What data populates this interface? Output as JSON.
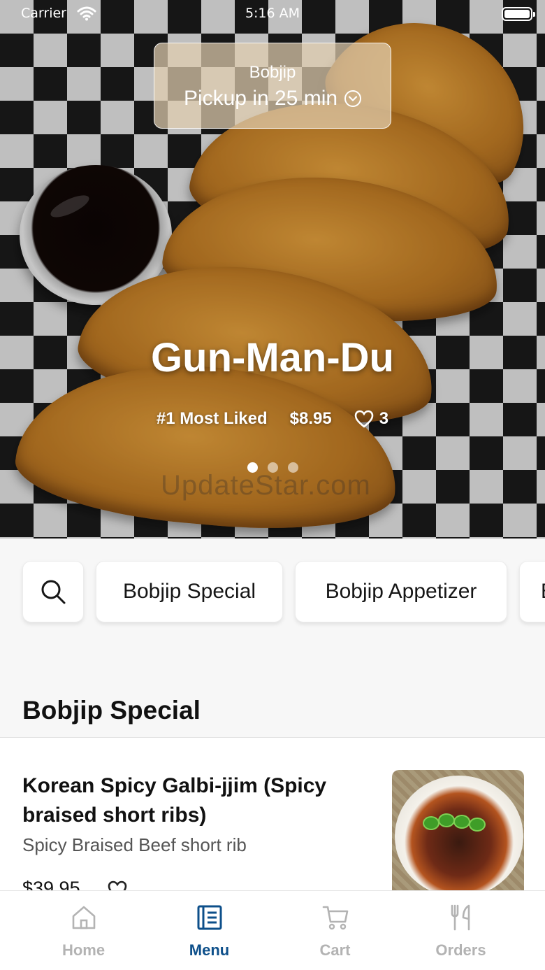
{
  "status_bar": {
    "carrier": "Carrier",
    "time": "5:16 AM"
  },
  "pickup": {
    "store": "Bobjip",
    "eta": "Pickup in 25 min"
  },
  "featured": {
    "title": "Gun-Man-Du",
    "badge": "#1 Most Liked",
    "price": "$8.95",
    "likes": "3",
    "slide_count": 3,
    "active_slide": 1
  },
  "watermark": "UpdateStar.com",
  "categories": [
    "Bobjip Special",
    "Bobjip Appetizer",
    "B"
  ],
  "section": {
    "title": "Bobjip Special"
  },
  "items": [
    {
      "name": "Korean Spicy Galbi-jjim (Spicy braised short ribs)",
      "description": "Spicy Braised Beef short rib",
      "price": "$39.95"
    }
  ],
  "tabs": [
    {
      "label": "Home",
      "icon": "home-icon"
    },
    {
      "label": "Menu",
      "icon": "menu-icon"
    },
    {
      "label": "Cart",
      "icon": "cart-icon"
    },
    {
      "label": "Orders",
      "icon": "utensils-icon"
    }
  ],
  "colors": {
    "accent": "#0d4f8a",
    "tab_inactive": "#b3b3b3"
  }
}
